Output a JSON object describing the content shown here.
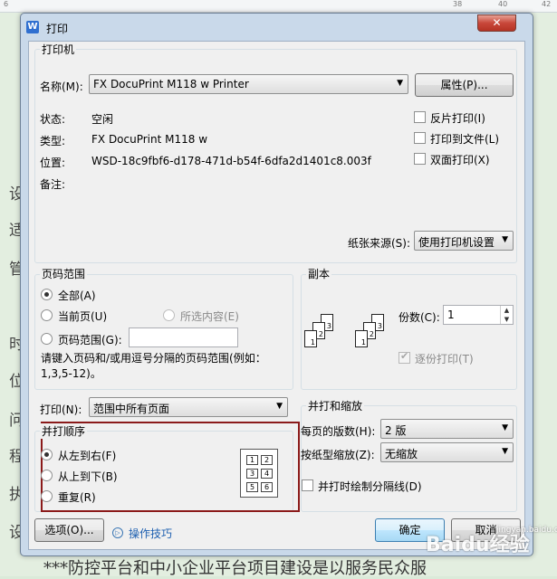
{
  "window": {
    "title": "打印",
    "close": "✕"
  },
  "printer": {
    "group": "打印机",
    "name_label": "名称(M):",
    "name_value": "FX DocuPrint M118 w Printer",
    "properties_btn": "属性(P)...",
    "status_label": "状态:",
    "status_value": "空闲",
    "type_label": "类型:",
    "type_value": "FX DocuPrint M118 w",
    "location_label": "位置:",
    "location_value": "WSD-18c9fbf6-d178-471d-b54f-6dfa2d1401c8.003f",
    "comment_label": "备注:",
    "reverse_print": "反片打印(I)",
    "print_to_file": "打印到文件(L)",
    "duplex": "双面打印(X)",
    "paper_source_label": "纸张来源(S):",
    "paper_source_value": "使用打印机设置"
  },
  "page_range": {
    "group": "页码范围",
    "all": "全部(A)",
    "current": "当前页(U)",
    "selection": "所选内容(E)",
    "pages": "页码范围(G):",
    "pages_value": "",
    "hint": "请键入页码和/或用逗号分隔的页码范围(例如：1,3,5-12)。"
  },
  "copies": {
    "group": "副本",
    "count_label": "份数(C):",
    "count_value": "1",
    "collate": "逐份打印(T)"
  },
  "print_what": {
    "label": "打印(N):",
    "value": "范围中所有页面"
  },
  "print_order": {
    "group": "并打顺序",
    "left_to_right": "从左到右(F)",
    "top_to_bottom": "从上到下(B)",
    "repeat": "重复(R)",
    "grid": [
      "1",
      "2",
      "3",
      "4",
      "5",
      "6"
    ]
  },
  "zoom": {
    "group": "并打和缩放",
    "pages_per_sheet_label": "每页的版数(H):",
    "pages_per_sheet_value": "2 版",
    "scale_label": "按纸型缩放(Z):",
    "scale_value": "无缩放",
    "draw_borders": "并打时绘制分隔线(D)"
  },
  "footer": {
    "options": "选项(O)...",
    "tips": "操作技巧",
    "ok": "确定",
    "cancel": "取消"
  },
  "background": {
    "chars": [
      "设",
      "适",
      "管",
      "时",
      "位",
      "问",
      "程",
      "执",
      "设"
    ],
    "bottom_line": "***防控平台和中小企业平台项目建设是以服务民众服",
    "ruler": [
      "6",
      "38",
      "40",
      "42"
    ]
  },
  "watermark": {
    "text": "Baidu经验",
    "sub": "jingyan.baidu.com"
  }
}
